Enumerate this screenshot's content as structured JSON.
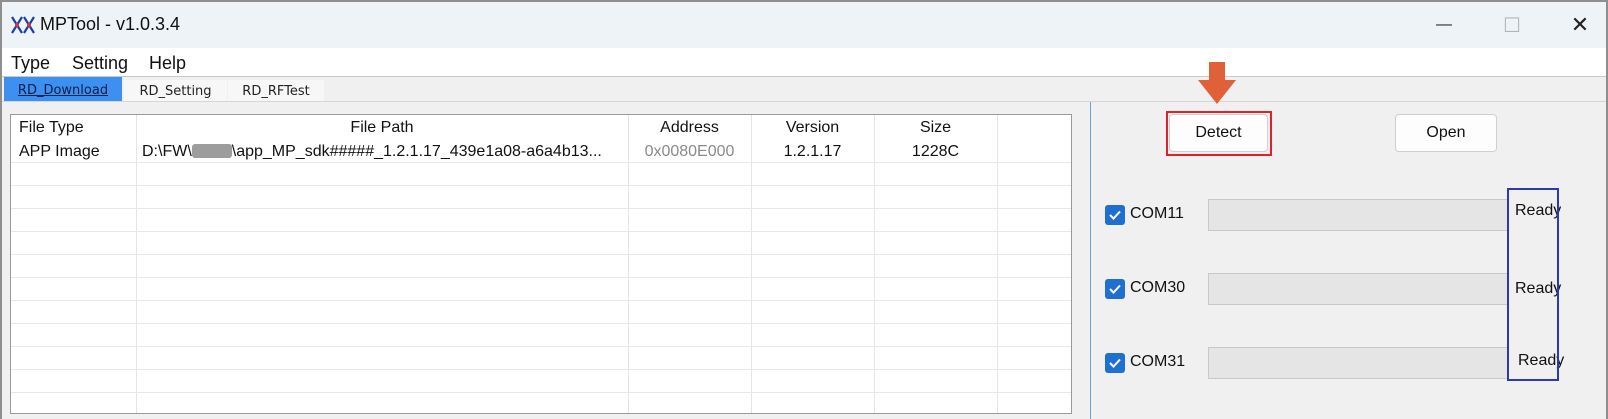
{
  "window": {
    "title": "MPTool - v1.0.3.4",
    "controls": {
      "minimize": "—",
      "maximize": "☐",
      "close": "✕"
    }
  },
  "menu": {
    "items": [
      "Type",
      "Setting",
      "Help"
    ]
  },
  "tabs": [
    {
      "label": "RD_Download",
      "active": true
    },
    {
      "label": "RD_Setting",
      "active": false
    },
    {
      "label": "RD_RFTest",
      "active": false
    }
  ],
  "table": {
    "headers": [
      "File Type",
      "File Path",
      "Address",
      "Version",
      "Size"
    ],
    "rows": [
      {
        "file_type": "APP Image",
        "file_path_prefix": "D:\\FW\\",
        "file_path_suffix": "\\app_MP_sdk#####_1.2.1.17_439e1a08-a6a4b13...",
        "address": "0x0080E000",
        "version": "1.2.1.17",
        "size": "1228C"
      }
    ]
  },
  "buttons": {
    "detect": "Detect",
    "open": "Open"
  },
  "ports": [
    {
      "name": "COM11",
      "checked": true,
      "status": "Ready"
    },
    {
      "name": "COM30",
      "checked": true,
      "status": "Ready"
    },
    {
      "name": "COM31",
      "checked": true,
      "status": "Ready"
    }
  ],
  "colors": {
    "active_tab": "#3d8ff0",
    "checkbox": "#1f6fd1",
    "detect_highlight": "#e0202a",
    "status_highlight": "#2b3ab0",
    "arrow": "#e0603a"
  },
  "icons": {
    "app": "realtek-logo-icon",
    "check": "checkmark-icon",
    "arrow": "down-arrow-icon"
  }
}
